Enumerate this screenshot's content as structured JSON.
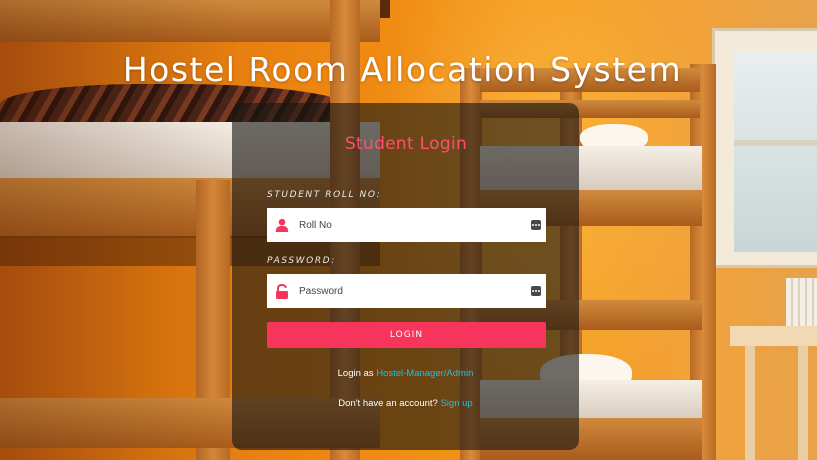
{
  "page": {
    "title": "Hostel Room Allocation System"
  },
  "login_card": {
    "heading": "Student Login",
    "roll_label": "STUDENT ROLL NO:",
    "roll_placeholder": "Roll No",
    "password_label": "PASSWORD:",
    "password_placeholder": "Password",
    "login_button": "LOGIN",
    "manager_prefix": "Login as ",
    "manager_link": "Hostel-Manager/Admin",
    "signup_prefix": "Don't have an account? ",
    "signup_link": "Sign up"
  },
  "icons": {
    "roll_icon": "user-icon",
    "password_icon": "unlock-icon",
    "field_action_icon": "more-dots-icon"
  },
  "colors": {
    "accent": "#f7355c",
    "heading": "#ff4f70",
    "link": "#1ec0e6",
    "card_overlay": "rgba(25,22,20,0.62)"
  }
}
